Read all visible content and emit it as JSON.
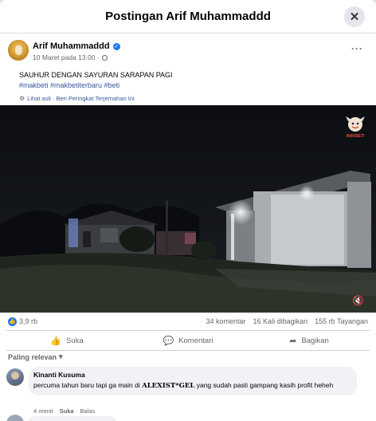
{
  "header": {
    "title": "Postingan Arif Muhammaddd",
    "close_glyph": "✕"
  },
  "post": {
    "author": "Arif Muhammaddd",
    "time": "10 Maret pada 13.00 ·",
    "caption": "SAUHUR DENGAN SAYURAN SARAPAN PAGI",
    "hashtags": "#makbeti #makbetiterbaru #beti",
    "translation_links": "Lihat asli · Beri Peringkat Terjemahan Ini",
    "more_glyph": "···"
  },
  "video": {
    "watermark_text": "MAKBETI",
    "mute_glyph": "🔇"
  },
  "stats": {
    "reactions": "3,9 rb",
    "comments": "34 komentar",
    "shares": "16 Kali dibagikan",
    "views": "155 rb Tayangan"
  },
  "actions": [
    {
      "label": "Suka",
      "icon": "like-icon",
      "glyph": "👍"
    },
    {
      "label": "Komentari",
      "icon": "comment-icon",
      "glyph": "💬"
    },
    {
      "label": "Bagikan",
      "icon": "share-icon",
      "glyph": "➦"
    }
  ],
  "sort_label": "Paling relevan",
  "comment": {
    "name": "Kinanti Kusuma",
    "text_before": "percuma tahun baru tapi ga main di ",
    "text_brand": "ALEXIST*GEL",
    "text_after": " yang sudah pasti gampang kasih profit heheh",
    "time": "4 menit",
    "like": "Suka",
    "reply": "Balas"
  },
  "colors": {
    "accent": "#1877f2",
    "link": "#385898",
    "muted": "#65676b"
  }
}
